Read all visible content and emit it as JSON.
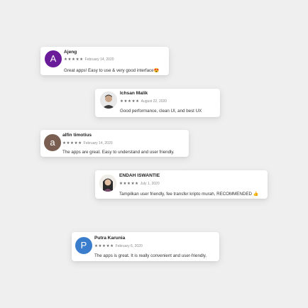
{
  "colors": {
    "background": "#efefef",
    "card": "#ffffff",
    "avatar_ajeng": "#6a1b9a",
    "avatar_alfin": "#7b5e52",
    "avatar_putra": "#3a7dcc"
  },
  "reviews": [
    {
      "avatar_letter": "A",
      "name": "Ajeng",
      "stars": "★★★★★",
      "date": "February 14, 2020",
      "text": "Great apps! Easy to use & very good interface😍"
    },
    {
      "avatar_icon": "person-photo-icon",
      "name": "Ichsan Malik",
      "stars": "★★★★★",
      "date": "August 22, 2020",
      "text": "Good performance, clean UI, and best UX"
    },
    {
      "avatar_letter": "a",
      "name": "alfin timotius",
      "stars": "★★★★★",
      "date": "February 14, 2020",
      "text": "The apps are great. Easy to understand and user friendly."
    },
    {
      "avatar_icon": "person-photo-icon",
      "name": "ENDAH ISWANTIE",
      "stars": "★★★★★",
      "date": "July 1, 2020",
      "text": "Tampilkan user friendly, fee transfer kripto murah, RECOMMENDED 👍"
    },
    {
      "avatar_letter": "P",
      "name": "Putra Karunia",
      "stars": "★★★★★",
      "date": "February 6, 2020",
      "text": "The apps is great. It is really convenient and user-friendly."
    }
  ]
}
